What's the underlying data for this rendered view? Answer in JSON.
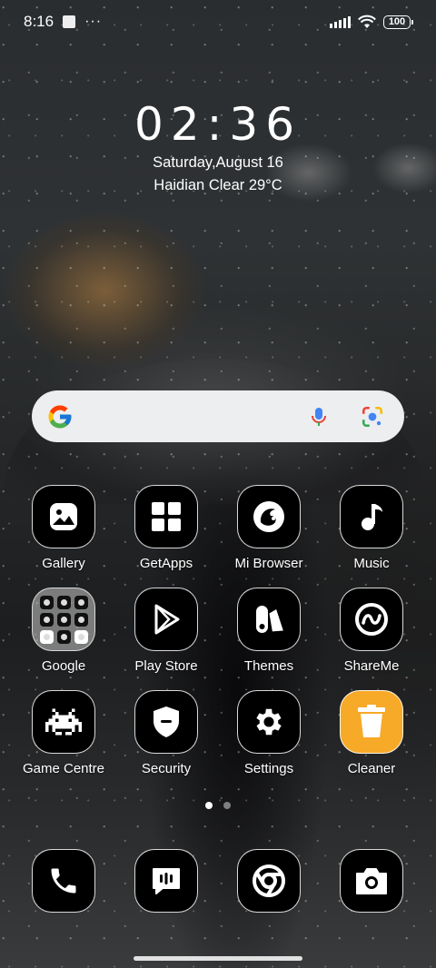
{
  "status_bar": {
    "time": "8:16",
    "more": "···",
    "battery": "100"
  },
  "clock_widget": {
    "time": "02:36",
    "date": "Saturday,August 16",
    "weather": "Haidian Clear 29°C"
  },
  "search": {
    "icons": [
      "google-logo-icon",
      "microphone-icon",
      "google-lens-icon"
    ]
  },
  "apps": [
    {
      "label": "Gallery",
      "icon": "gallery-icon"
    },
    {
      "label": "GetApps",
      "icon": "getapps-icon"
    },
    {
      "label": "Mi Browser",
      "icon": "browser-icon"
    },
    {
      "label": "Music",
      "icon": "music-note-icon"
    },
    {
      "label": "Google",
      "icon": "folder-icon"
    },
    {
      "label": "Play Store",
      "icon": "play-store-icon"
    },
    {
      "label": "Themes",
      "icon": "themes-icon"
    },
    {
      "label": "ShareMe",
      "icon": "shareme-icon"
    },
    {
      "label": "Game Centre",
      "icon": "game-invader-icon"
    },
    {
      "label": "Security",
      "icon": "shield-icon"
    },
    {
      "label": "Settings",
      "icon": "gear-icon"
    },
    {
      "label": "Cleaner",
      "icon": "trash-icon"
    }
  ],
  "dock": [
    {
      "icon": "phone-icon"
    },
    {
      "icon": "messages-icon"
    },
    {
      "icon": "chrome-icon"
    },
    {
      "icon": "camera-icon"
    }
  ],
  "page_indicator": {
    "pages": 2,
    "current": 1
  },
  "colors": {
    "cleaner_accent": "#f7a928",
    "search_bg": "#eceef0"
  }
}
